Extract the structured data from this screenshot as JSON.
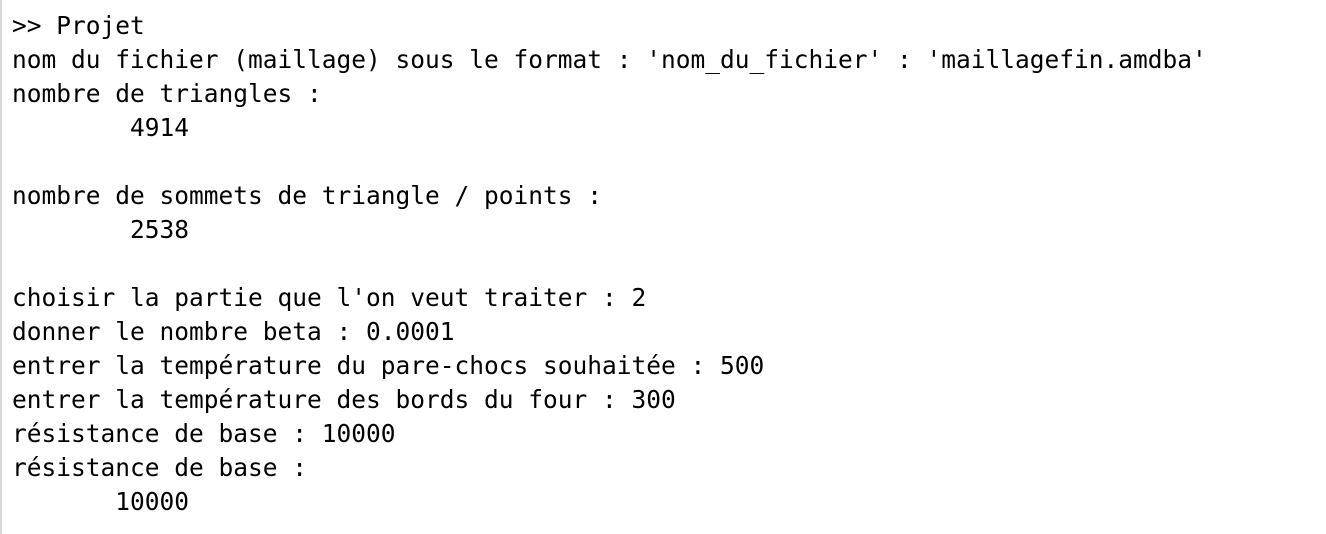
{
  "console": {
    "lines": [
      ">> Projet",
      "nom du fichier (maillage) sous le format : 'nom_du_fichier' : 'maillagefin.amdba'",
      "nombre de triangles :",
      "        4914",
      "",
      "nombre de sommets de triangle / points :",
      "        2538",
      "",
      "choisir la partie que l'on veut traiter : 2",
      "donner le nombre beta : 0.0001",
      "entrer la température du pare-chocs souhaitée : 500",
      "entrer la température des bords du four : 300",
      "résistance de base : 10000",
      "résistance de base :",
      "       10000"
    ]
  }
}
